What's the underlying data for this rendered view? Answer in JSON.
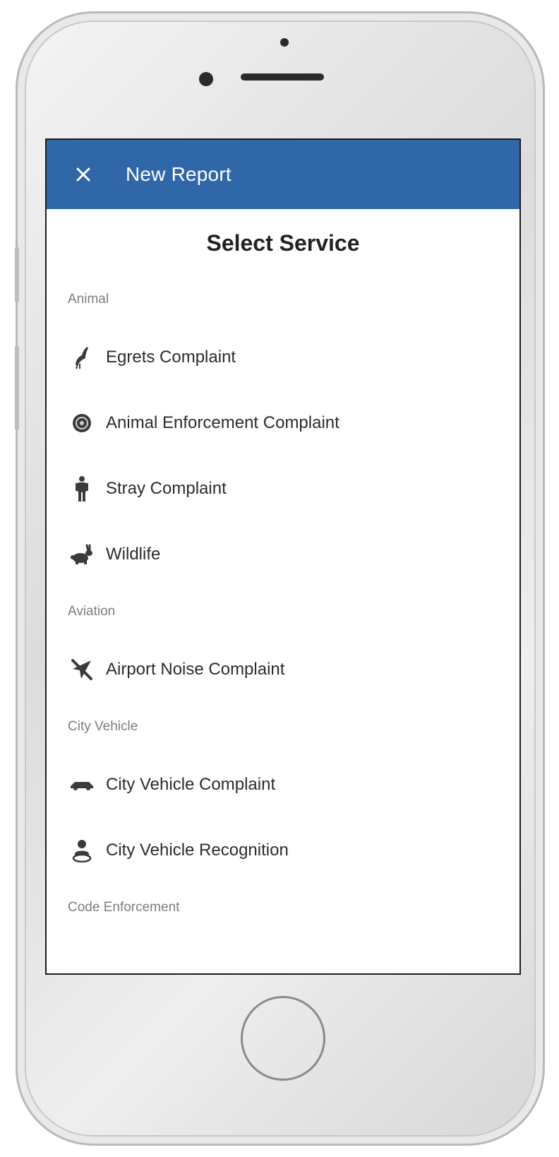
{
  "header": {
    "title": "New Report",
    "close_icon": "close-icon"
  },
  "heading": "Select Service",
  "sections": [
    {
      "label": "Animal",
      "items": [
        {
          "label": "Egrets Complaint",
          "icon": "bird-icon"
        },
        {
          "label": "Animal Enforcement Complaint",
          "icon": "badge-icon"
        },
        {
          "label": "Stray Complaint",
          "icon": "person-icon"
        },
        {
          "label": "Wildlife",
          "icon": "rabbit-icon"
        }
      ]
    },
    {
      "label": "Aviation",
      "items": [
        {
          "label": "Airport Noise Complaint",
          "icon": "airplane-icon"
        }
      ]
    },
    {
      "label": "City Vehicle",
      "items": [
        {
          "label": "City Vehicle Complaint",
          "icon": "car-icon"
        },
        {
          "label": "City Vehicle Recognition",
          "icon": "user-recognition-icon"
        }
      ]
    },
    {
      "label": "Code Enforcement",
      "items": []
    }
  ],
  "colors": {
    "appbar": "#2f67a8",
    "section_text": "#7d7d7d",
    "item_text": "#2c2c2c"
  }
}
